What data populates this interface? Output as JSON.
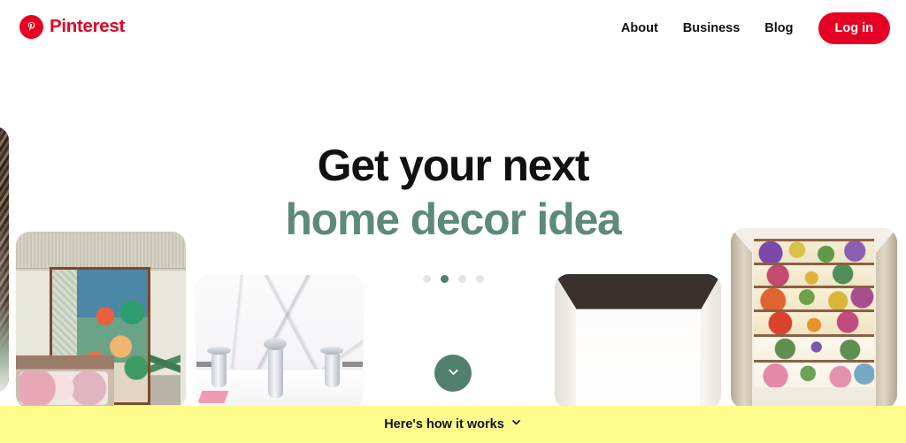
{
  "header": {
    "brand": {
      "name": "Pinterest",
      "icon": "pinterest-logo-icon",
      "color": "#e60023"
    },
    "nav_links": [
      {
        "label": "About"
      },
      {
        "label": "Business"
      },
      {
        "label": "Blog"
      }
    ],
    "login_label": "Log in"
  },
  "hero": {
    "line1": "Get your next",
    "line2": "home decor idea",
    "line1_color": "#111111",
    "line2_color": "#5d8a76",
    "carousel": {
      "total_dots": 4,
      "active_index": 1,
      "active_color": "#4e8070",
      "inactive_color": "#e4e4e4"
    },
    "scroll_button": {
      "icon": "chevron-down-icon",
      "background": "#52806f"
    }
  },
  "collage": {
    "cards": [
      {
        "name": "edge-sliver-image",
        "alt": "Dark textured decor photo partially off-screen"
      },
      {
        "name": "mural-bedroom-image",
        "alt": "Bedroom with colorful tropical mural and plant"
      },
      {
        "name": "marble-bathroom-image",
        "alt": "White marble backsplash with chrome faucets"
      },
      {
        "name": "minimal-room-image",
        "alt": "Minimal white room with dark ceiling"
      },
      {
        "name": "floral-stairs-image",
        "alt": "Staircase with floral patterned risers"
      }
    ]
  },
  "bottom_bar": {
    "label": "Here's how it works",
    "icon": "chevron-down-icon",
    "background": "#fdfb8c"
  }
}
